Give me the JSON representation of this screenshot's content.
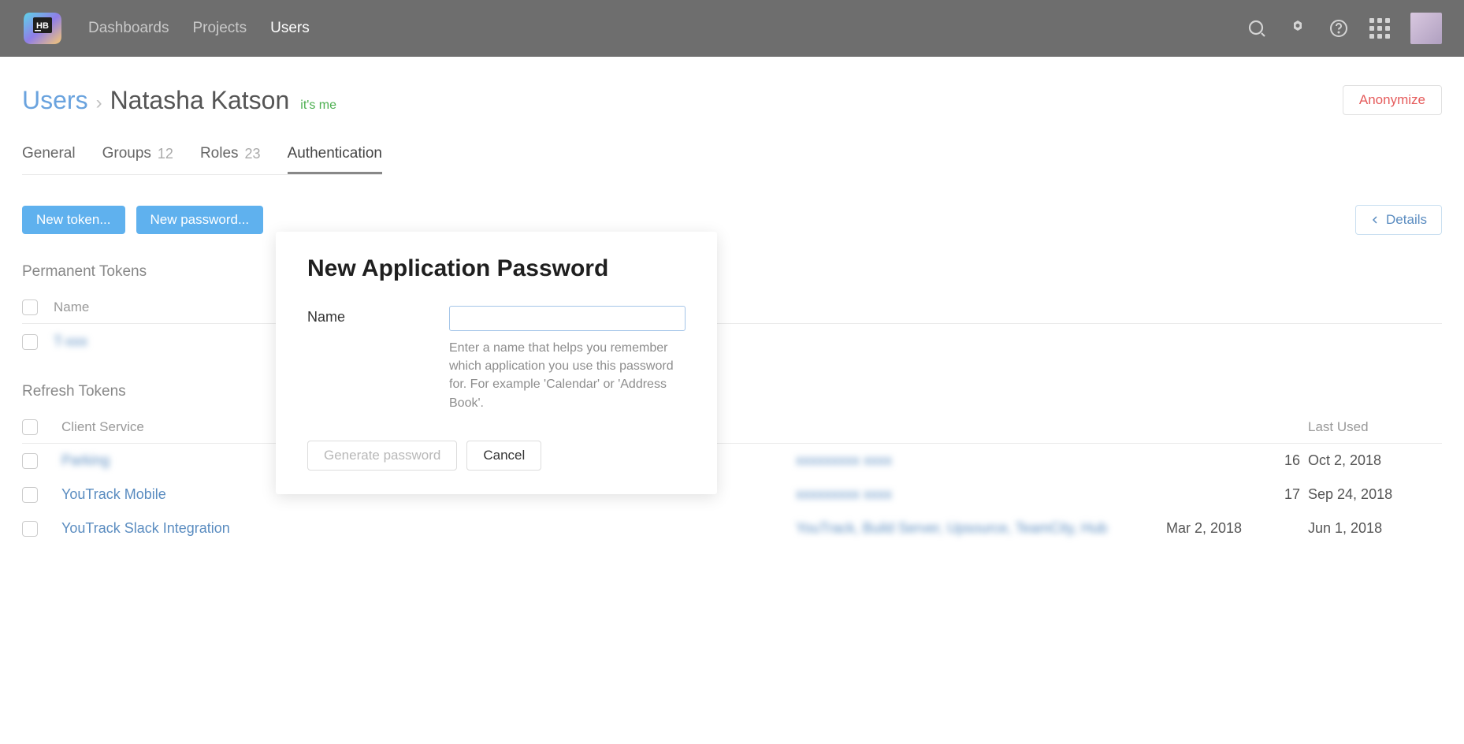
{
  "header": {
    "nav": [
      "Dashboards",
      "Projects",
      "Users"
    ],
    "active_nav": "Users"
  },
  "breadcrumb": {
    "root": "Users",
    "name": "Natasha Katson",
    "tag": "it's me"
  },
  "buttons": {
    "anonymize": "Anonymize",
    "new_token": "New token...",
    "new_password": "New password...",
    "details": "Details"
  },
  "tabs": [
    {
      "label": "General",
      "count": ""
    },
    {
      "label": "Groups",
      "count": "12"
    },
    {
      "label": "Roles",
      "count": "23"
    },
    {
      "label": "Authentication",
      "count": "",
      "active": true
    }
  ],
  "permanent_tokens": {
    "title": "Permanent Tokens",
    "col_name": "Name",
    "rows": [
      {
        "name": "T-xxx",
        "blurred": true
      }
    ]
  },
  "refresh_tokens": {
    "title": "Refresh Tokens",
    "cols": {
      "client": "Client Service",
      "scope": "",
      "created": "",
      "last_used": "Last Used"
    },
    "rows": [
      {
        "client": "Parking",
        "client_blurred": true,
        "scope": "blurred",
        "created": "16",
        "last_used": "Oct 2, 2018"
      },
      {
        "client": "YouTrack Mobile",
        "client_blurred": false,
        "scope": "blurred",
        "created": "17",
        "last_used": "Sep 24, 2018"
      },
      {
        "client": "YouTrack Slack Integration",
        "client_blurred": false,
        "scope": "YouTrack, Build Server, Upsource, TeamCity, Hub",
        "scope_blurred": true,
        "created": "Mar 2, 2018",
        "last_used": "Jun 1, 2018"
      }
    ]
  },
  "dialog": {
    "title": "New Application Password",
    "name_label": "Name",
    "name_help": "Enter a name that helps you remember which application you use this password for. For example 'Calendar' or 'Address Book'.",
    "generate": "Generate password",
    "cancel": "Cancel"
  }
}
